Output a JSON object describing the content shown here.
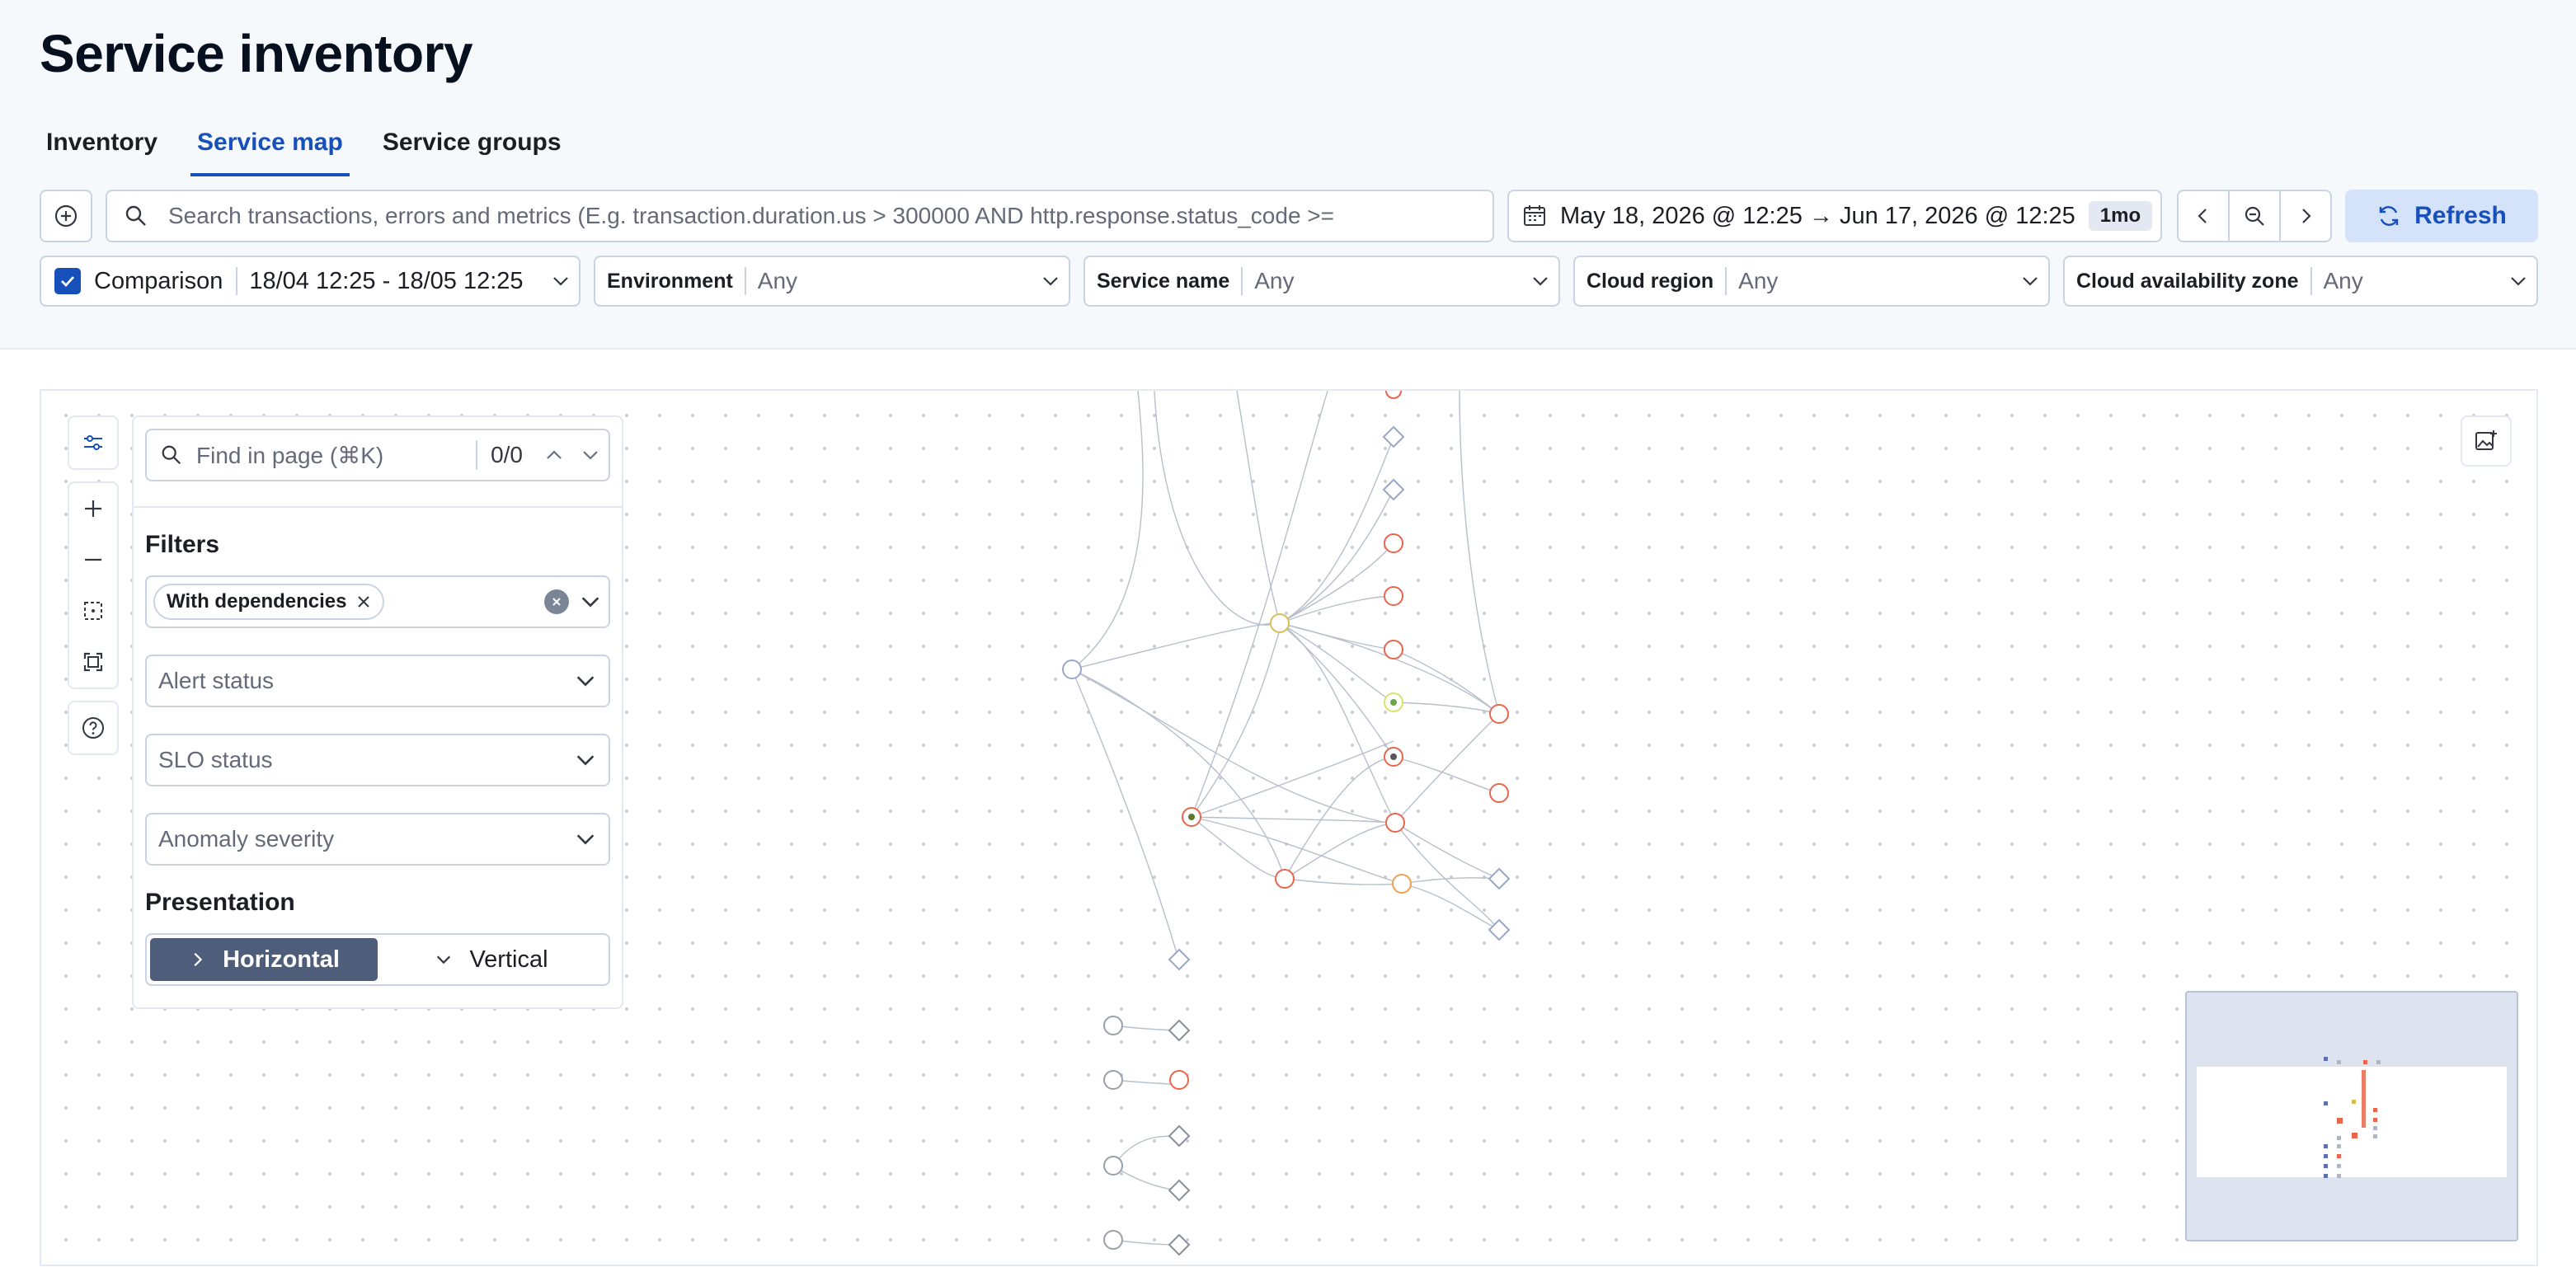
{
  "page": {
    "title": "Service inventory"
  },
  "tabs": [
    {
      "label": "Inventory"
    },
    {
      "label": "Service map"
    },
    {
      "label": "Service groups"
    }
  ],
  "search": {
    "placeholder": "Search transactions, errors and metrics (E.g. transaction.duration.us > 300000 AND http.response.status_code >="
  },
  "date": {
    "range": "May 18, 2026 @ 12:25 → Jun 17, 2026 @ 12:25",
    "badge": "1mo"
  },
  "refresh": {
    "label": "Refresh"
  },
  "filters": {
    "comparison": {
      "label": "Comparison",
      "value": "18/04 12:25 - 18/05 12:25",
      "checked": true
    },
    "environment": {
      "label": "Environment",
      "value": "Any"
    },
    "service_name": {
      "label": "Service name",
      "value": "Any"
    },
    "cloud_region": {
      "label": "Cloud region",
      "value": "Any"
    },
    "cloud_zone": {
      "label": "Cloud availability zone",
      "value": "Any"
    }
  },
  "panel": {
    "find_placeholder": "Find in page (⌘K)",
    "find_count": "0/0",
    "filters_title": "Filters",
    "chip": "With dependencies",
    "alert_status": "Alert status",
    "slo_status": "SLO status",
    "anomaly_severity": "Anomaly severity",
    "presentation_title": "Presentation",
    "horizontal": "Horizontal",
    "vertical": "Vertical"
  },
  "colors": {
    "accent": "#1750ba",
    "critical": "#e7664c",
    "warning": "#d6bf57",
    "node": "#98a2b3"
  }
}
